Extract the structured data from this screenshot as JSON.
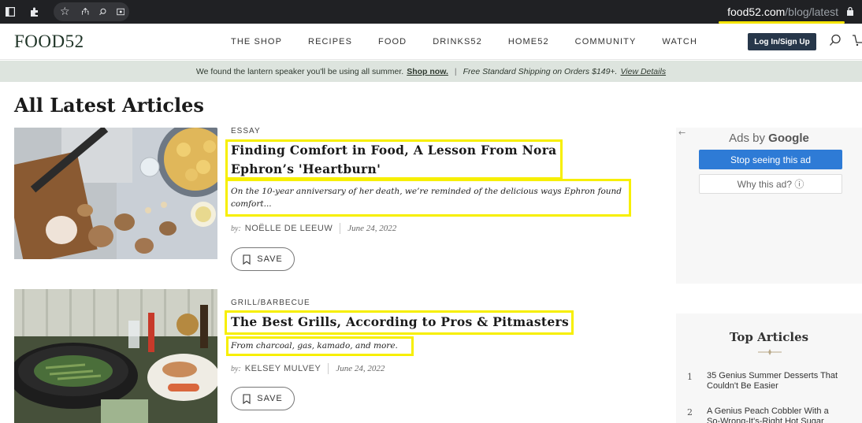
{
  "browser": {
    "url_host": "food52.com",
    "url_path": "/blog/latest"
  },
  "header": {
    "logo": "FOOD52",
    "nav": [
      "THE SHOP",
      "RECIPES",
      "FOOD",
      "DRINKS52",
      "HOME52",
      "COMMUNITY",
      "WATCH"
    ],
    "login_label": "Log In/Sign Up"
  },
  "promo": {
    "text": "We found the lantern speaker you'll be using all summer.",
    "link": "Shop now.",
    "separator": "|",
    "shipping": "Free Standard Shipping on Orders $149+.",
    "details_link": "View Details"
  },
  "page": {
    "title": "All Latest Articles"
  },
  "articles": [
    {
      "category": "ESSAY",
      "title_line1": "Finding Comfort in Food, A Lesson From Nora",
      "title_line2": "Ephron’s 'Heartburn'",
      "dek_line1": "On the 10-year anniversary of her death, we’re reminded of the delicious ways Ephron found",
      "dek_line2": "comfort...",
      "by": "by:",
      "author": "NOËLLE DE LEEUW",
      "date": "June 24, 2022",
      "save_label": "SAVE"
    },
    {
      "category": "GRILL/BARBECUE",
      "title_line1": "The Best Grills, According to Pros & Pitmasters",
      "dek_line1": "From charcoal, gas, kamado, and more.",
      "by": "by:",
      "author": "KELSEY MULVEY",
      "date": "June 24, 2022",
      "save_label": "SAVE"
    }
  ],
  "ads": {
    "back_arrow": "←",
    "ads_by": "Ads by",
    "google": "Google",
    "stop_label": "Stop seeing this ad",
    "why_label": "Why this ad? ⓘ"
  },
  "top_articles": {
    "title": "Top Articles",
    "items": [
      {
        "num": "1",
        "line1": "35 Genius Summer Desserts That",
        "line2": "Couldn't Be Easier"
      },
      {
        "num": "2",
        "line1": "A Genius Peach Cobbler With a",
        "line2": "So-Wrong-It's-Right Hot Sugar"
      }
    ]
  },
  "colors": {
    "highlight": "#f7ef00",
    "login_bg": "#27374a",
    "promo_bg": "#dde4de",
    "ad_button": "#2e7bd6"
  }
}
